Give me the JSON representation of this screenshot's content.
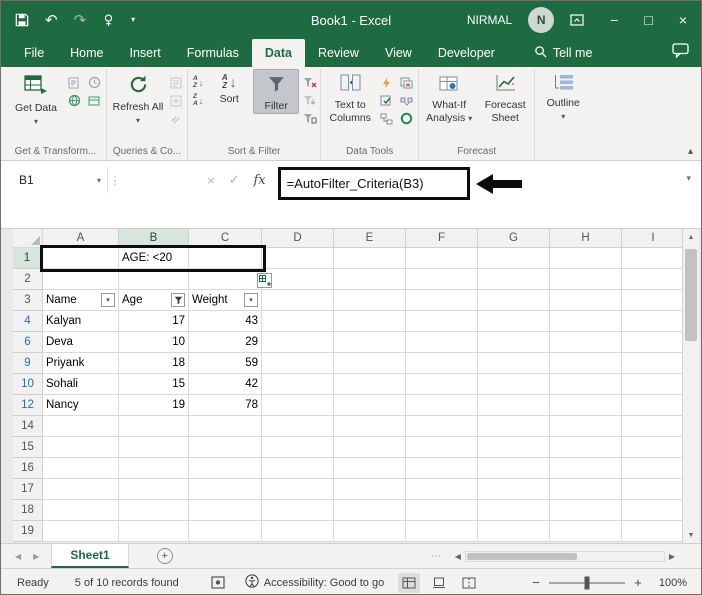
{
  "colors": {
    "excel_green": "#1e6b41",
    "filtered_row_blue": "#2a6db4"
  },
  "titlebar": {
    "title": "Book1 - Excel",
    "user_name": "NIRMAL",
    "user_initial": "N"
  },
  "tabs": {
    "items": [
      "File",
      "Home",
      "Insert",
      "Formulas",
      "Data",
      "Review",
      "View",
      "Developer"
    ],
    "active": "Data",
    "tell_me": "Tell me"
  },
  "ribbon": {
    "get_data": "Get Data",
    "refresh_all": "Refresh All",
    "sort": "Sort",
    "filter": "Filter",
    "text_to_columns": "Text to Columns",
    "what_if_analysis": "What-If Analysis",
    "forecast_sheet": "Forecast Sheet",
    "outline": "Outline",
    "group_labels": {
      "get_transform": "Get & Transform...",
      "queries": "Queries & Co...",
      "sort_filter": "Sort & Filter",
      "data_tools": "Data Tools",
      "forecast": "Forecast"
    }
  },
  "formula_bar": {
    "name_box": "B1",
    "fx": "fx",
    "formula": "=AutoFilter_Criteria(B3)"
  },
  "sheet": {
    "columns": [
      "A",
      "B",
      "C",
      "D",
      "E",
      "F",
      "G",
      "H",
      "I"
    ],
    "selected_column": "B",
    "selected_row": "1",
    "rows": [
      {
        "n": "1",
        "cells": {
          "B": "AGE: <20"
        }
      },
      {
        "n": "2",
        "cells": {}
      },
      {
        "n": "3",
        "cells": {
          "A": "Name",
          "B": "Age",
          "C": "Weight"
        },
        "filters": {
          "A": "dropdown",
          "B": "active",
          "C": "dropdown"
        }
      },
      {
        "n": "4",
        "blue": true,
        "cells": {
          "A": "Kalyan",
          "B": "17",
          "C": "43"
        }
      },
      {
        "n": "6",
        "blue": true,
        "cells": {
          "A": "Deva",
          "B": "10",
          "C": "29"
        }
      },
      {
        "n": "9",
        "blue": true,
        "cells": {
          "A": "Priyank",
          "B": "18",
          "C": "59"
        }
      },
      {
        "n": "10",
        "blue": true,
        "cells": {
          "A": "Sohali",
          "B": "15",
          "C": "42"
        }
      },
      {
        "n": "12",
        "blue": true,
        "cells": {
          "A": "Nancy",
          "B": "19",
          "C": "78"
        }
      },
      {
        "n": "14",
        "cells": {}
      },
      {
        "n": "15",
        "cells": {}
      },
      {
        "n": "16",
        "cells": {}
      },
      {
        "n": "17",
        "cells": {}
      },
      {
        "n": "18",
        "cells": {}
      },
      {
        "n": "19",
        "cells": {}
      }
    ]
  },
  "sheet_tabs": {
    "active": "Sheet1"
  },
  "status_bar": {
    "mode": "Ready",
    "records": "5 of 10 records found",
    "accessibility": "Accessibility: Good to go",
    "zoom_level": "100%"
  },
  "icons": {
    "dropdown": "▾",
    "undo": "↶",
    "redo": "↷",
    "minimize": "−",
    "maximize": "□",
    "close": "×",
    "cancel": "×",
    "enter": "✓",
    "dots": "⋮",
    "ellipsis": "⋯",
    "collapse": "▴",
    "expand": "▾",
    "sort_a": "A",
    "sort_z": "Z",
    "arrow_down": "↓",
    "left": "◀",
    "right": "▶",
    "up": "▲",
    "down": "▼",
    "plus": "+",
    "minus": "−",
    "add_sheet": "+"
  }
}
